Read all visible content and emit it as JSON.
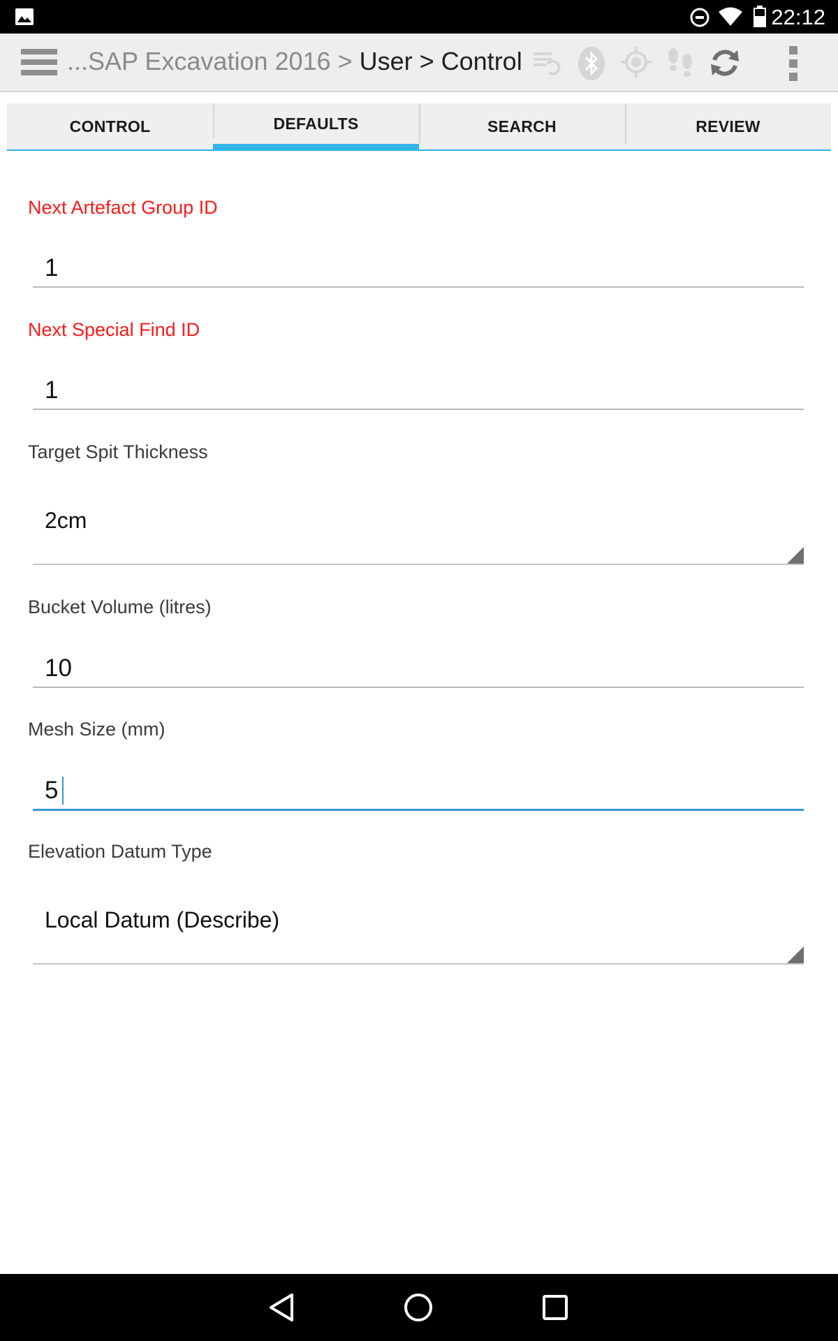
{
  "status_bar": {
    "time": "22:12",
    "icons": [
      "gallery-icon",
      "do-not-disturb-icon",
      "wifi-icon",
      "battery-icon"
    ]
  },
  "action_bar": {
    "title_prefix": "...SAP Excavation 2016 > ",
    "title_current": "User > Control",
    "icons": [
      "menu-icon",
      "sync-list-icon",
      "bluetooth-icon",
      "gps-icon",
      "footsteps-icon",
      "sync-icon",
      "overflow-menu-icon"
    ]
  },
  "tabs": [
    {
      "label": "CONTROL",
      "active": false
    },
    {
      "label": "DEFAULTS",
      "active": true
    },
    {
      "label": "SEARCH",
      "active": false
    },
    {
      "label": "REVIEW",
      "active": false
    }
  ],
  "form": {
    "artefact_group": {
      "label": "Next Artefact Group ID",
      "value": "1",
      "required": true
    },
    "special_find": {
      "label": "Next Special Find ID",
      "value": "1",
      "required": true
    },
    "spit_thickness": {
      "label": "Target Spit Thickness",
      "value": "2cm"
    },
    "bucket_volume": {
      "label": "Bucket Volume (litres)",
      "value": "10"
    },
    "mesh_size": {
      "label": "Mesh Size (mm)",
      "value": "5",
      "focused": true
    },
    "elevation_datum": {
      "label": "Elevation Datum Type",
      "value": "Local Datum (Describe)"
    }
  },
  "colors": {
    "accent": "#33b5e5",
    "required_label": "#ff1a1a",
    "focus_line": "#3399cc"
  },
  "nav_bar": {
    "icons": [
      "back-icon",
      "home-icon",
      "recents-icon"
    ]
  }
}
